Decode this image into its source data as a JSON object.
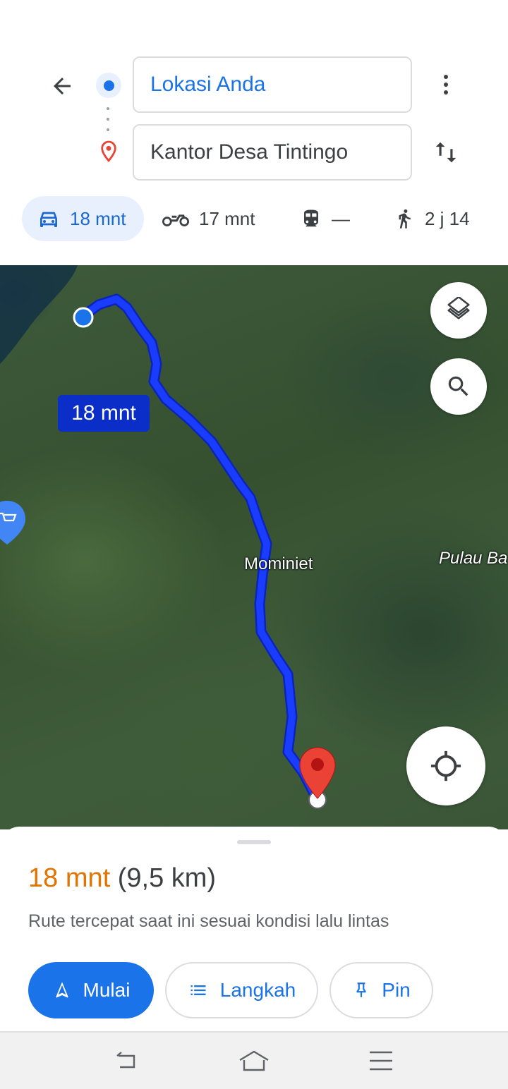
{
  "directions": {
    "origin_value": "Lokasi Anda",
    "destination_value": "Kantor Desa Tintingo"
  },
  "modes": [
    {
      "icon": "car-icon",
      "label": "18 mnt",
      "active": true
    },
    {
      "icon": "motorcycle-icon",
      "label": "17 mnt"
    },
    {
      "icon": "train-icon",
      "label": "—"
    },
    {
      "icon": "walk-icon",
      "label": "2 j 14"
    }
  ],
  "map": {
    "route_label": "18 mnt",
    "places": [
      "Mominiet",
      "Pulau Ba"
    ],
    "route_color": "#1a3cff"
  },
  "sheet": {
    "duration": "18 mnt",
    "distance": "(9,5 km)",
    "description": "Rute tercepat saat ini sesuai kondisi lalu lintas",
    "start_label": "Mulai",
    "steps_label": "Langkah",
    "pin_label": "Pin"
  },
  "colors": {
    "accent": "#1a73e8",
    "duration": "#e37400",
    "destination_pin": "#ea4335"
  }
}
